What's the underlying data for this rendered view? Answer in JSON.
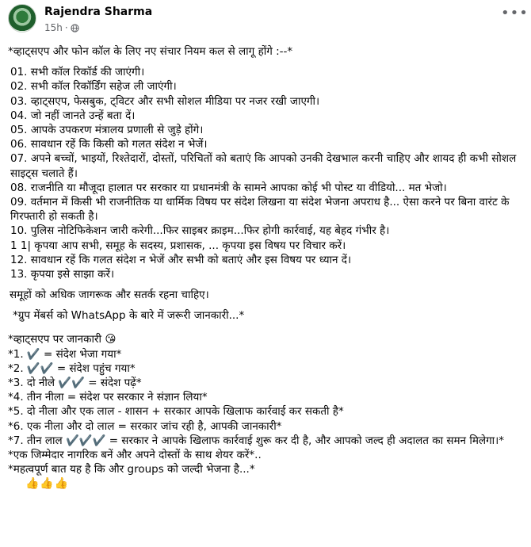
{
  "post": {
    "author": "Rajendra Sharma",
    "time": "15h",
    "dot": "·",
    "lines": [
      "*व्हाट्सएप और फोन कॉल के लिए नए संचार नियम कल से लागू होंगे :--*",
      "01.  सभी कॉल रिकॉर्ड की जाएंगी।",
      "02.  सभी कॉल रिकॉर्डिंग सहेज ली जाएंगी।",
      "03.  व्हाट्सएप, फेसबुक, ट्विटर और सभी सोशल मीडिया पर नजर रखी जाएगी।",
      "04.  जो नहीं जानते उन्हें बता दें।",
      "05.  आपके उपकरण मंत्रालय प्रणाली से जुड़े होंगे।",
      "06.  सावधान रहें कि किसी को गलत संदेश न भेजें।",
      "07.  अपने बच्चों, भाइयों, रिश्तेदारों, दोस्तों, परिचितों को बताएं कि आपको उनकी देखभाल करनी चाहिए और शायद ही कभी सोशल साइट्स चलाते हैं।",
      "08.  राजनीति या मौजूदा हालात पर सरकार या प्रधानमंत्री के सामने आपका कोई भी पोस्ट या वीडियो...  मत भेजो।",
      "09.  वर्तमान में किसी भी राजनीतिक या धार्मिक विषय पर संदेश लिखना या संदेश भेजना अपराध है... ऐसा करने पर बिना वारंट के गिरफ्तारी हो सकती है।",
      "10.  पुलिस नोटिफिकेशन जारी करेगी...फिर साइबर क्राइम...फिर होगी कार्रवाई, यह बेहद गंभीर है।",
      "1 1|  कृपया आप सभी, समूह के सदस्य, प्रशासक, ... कृपया इस विषय पर विचार करें।",
      "12.  सावधान रहें कि गलत संदेश न भेजें और सभी को बताएं और इस विषय पर ध्यान दें।",
      "13.  कृपया इसे साझा करें।",
      "समूहों को अधिक जागरूक और सतर्क रहना चाहिए।",
      "*ग्रुप मेंबर्स को WhatsApp के बारे में जरूरी जानकारी...*",
      "*व्हाट्सएप पर जानकारी 😘",
      "*1.  ✔️ = संदेश भेजा गया*",
      "*2.  ✔️✔️ = संदेश पहुंच गया*",
      "*3. दो नीले ✔️✔️ = संदेश पढ़ें*",
      "*4. तीन नीला = संदेश पर सरकार ने संज्ञान लिया*",
      "*5. दो नीला और एक लाल - शासन + सरकार आपके खिलाफ कार्रवाई कर सकती है*",
      "*6. एक नीला और दो लाल = सरकार जांच रही है, आपकी जानकारी*",
      "*7. तीन लाल ✔️✔️✔️ = सरकार ने आपके खिलाफ कार्रवाई शुरू कर दी है, और आपको जल्द ही अदालत का समन मिलेगा।*",
      "*एक जिम्मेदार नागरिक बनें और अपने दोस्तों के साथ शेयर करें*..",
      "*महत्वपूर्ण बात यह है कि और groups को जल्दी भेजना है...*",
      "👍👍👍"
    ]
  },
  "icons": {
    "privacy": "globe-icon",
    "menu": "more-options-icon"
  }
}
